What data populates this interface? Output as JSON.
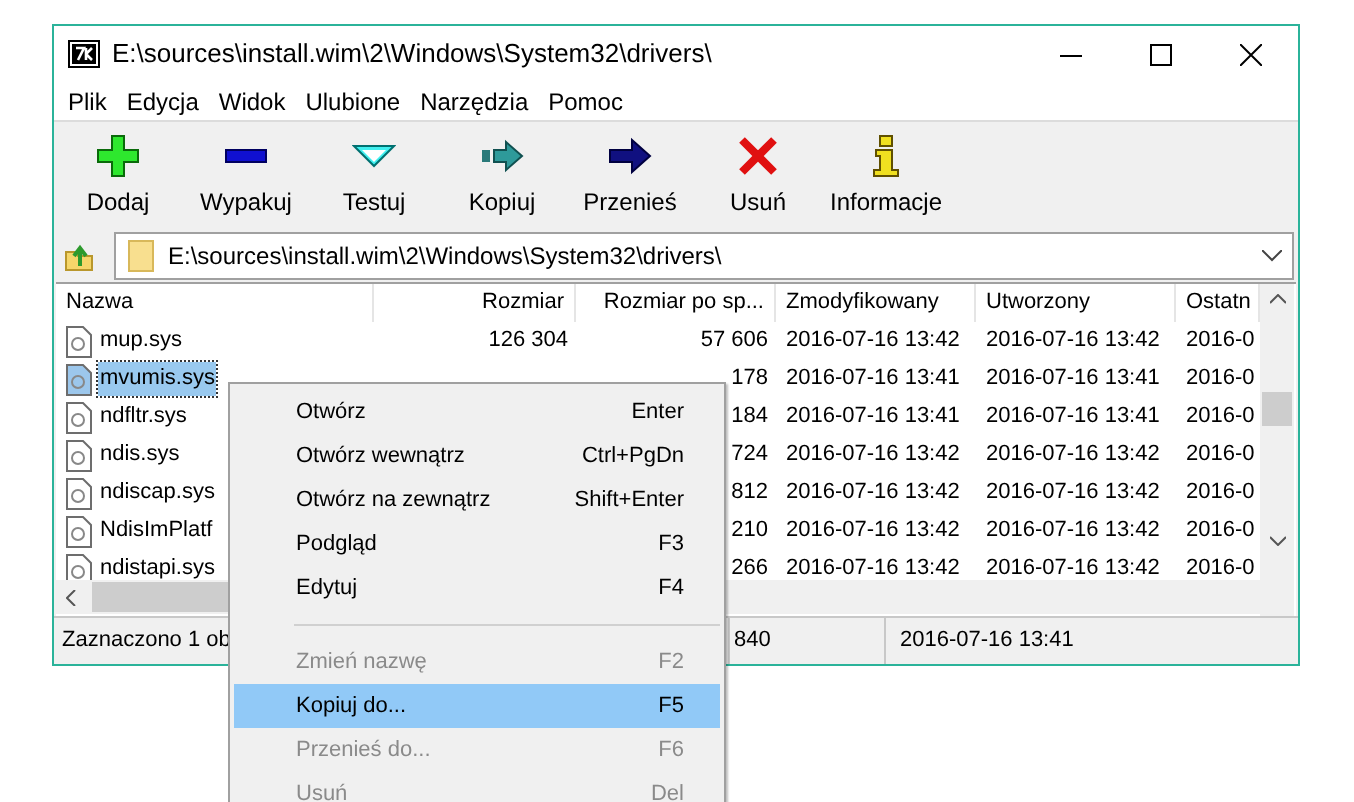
{
  "window": {
    "title": "E:\\sources\\install.wim\\2\\Windows\\System32\\drivers\\"
  },
  "menu_bar": [
    "Plik",
    "Edycja",
    "Widok",
    "Ulubione",
    "Narzędzia",
    "Pomoc"
  ],
  "toolbar": [
    {
      "kind": "add",
      "label": "Dodaj"
    },
    {
      "kind": "extract",
      "label": "Wypakuj"
    },
    {
      "kind": "test",
      "label": "Testuj"
    },
    {
      "kind": "copy",
      "label": "Kopiuj"
    },
    {
      "kind": "move",
      "label": "Przenieś"
    },
    {
      "kind": "delete",
      "label": "Usuń"
    },
    {
      "kind": "info",
      "label": "Informacje"
    }
  ],
  "address_bar": {
    "value": "E:\\sources\\install.wim\\2\\Windows\\System32\\drivers\\"
  },
  "table": {
    "columns": [
      "Nazwa",
      "Rozmiar",
      "Rozmiar po sp...",
      "Zmodyfikowany",
      "Utworzony",
      "Ostatn"
    ],
    "rows": [
      {
        "name": "mup.sys",
        "size": "126 304",
        "packed": "57 606",
        "modified": "2016-07-16 13:42",
        "created": "2016-07-16 13:42",
        "accessed": "2016-0",
        "selected": false
      },
      {
        "name": "mvumis.sys",
        "packed": "178",
        "modified": "2016-07-16 13:41",
        "created": "2016-07-16 13:41",
        "accessed": "2016-0",
        "selected": true
      },
      {
        "name": "ndfltr.sys",
        "packed": "184",
        "modified": "2016-07-16 13:41",
        "created": "2016-07-16 13:41",
        "accessed": "2016-0",
        "selected": false
      },
      {
        "name": "ndis.sys",
        "packed": "724",
        "modified": "2016-07-16 13:42",
        "created": "2016-07-16 13:42",
        "accessed": "2016-0",
        "selected": false
      },
      {
        "name": "ndiscap.sys",
        "packed": "812",
        "modified": "2016-07-16 13:42",
        "created": "2016-07-16 13:42",
        "accessed": "2016-0",
        "selected": false
      },
      {
        "name": "NdisImPlatf",
        "packed": "210",
        "modified": "2016-07-16 13:42",
        "created": "2016-07-16 13:42",
        "accessed": "2016-0",
        "selected": false
      },
      {
        "name": "ndistapi.sys",
        "packed": "266",
        "modified": "2016-07-16 13:42",
        "created": "2016-07-16 13:42",
        "accessed": "2016-0",
        "selected": false
      }
    ]
  },
  "status_bar": [
    "Zaznaczono 1 ob",
    "840",
    "2016-07-16 13:41"
  ],
  "context_menu": [
    {
      "kind": "item",
      "label": "Otwórz",
      "shortcut": "Enter",
      "disabled": false,
      "selected": false
    },
    {
      "kind": "item",
      "label": "Otwórz wewnątrz",
      "shortcut": "Ctrl+PgDn",
      "disabled": false,
      "selected": false
    },
    {
      "kind": "item",
      "label": "Otwórz na zewnątrz",
      "shortcut": "Shift+Enter",
      "disabled": false,
      "selected": false
    },
    {
      "kind": "item",
      "label": "Podgląd",
      "shortcut": "F3",
      "disabled": false,
      "selected": false
    },
    {
      "kind": "item",
      "label": "Edytuj",
      "shortcut": "F4",
      "disabled": false,
      "selected": false
    },
    {
      "kind": "separator"
    },
    {
      "kind": "item",
      "label": "Zmień nazwę",
      "shortcut": "F2",
      "disabled": true,
      "selected": false
    },
    {
      "kind": "item",
      "label": "Kopiuj do...",
      "shortcut": "F5",
      "disabled": false,
      "selected": true
    },
    {
      "kind": "item",
      "label": "Przenieś do...",
      "shortcut": "F6",
      "disabled": true,
      "selected": false
    },
    {
      "kind": "item",
      "label": "Usuń",
      "shortcut": "Del",
      "disabled": true,
      "selected": false
    }
  ]
}
